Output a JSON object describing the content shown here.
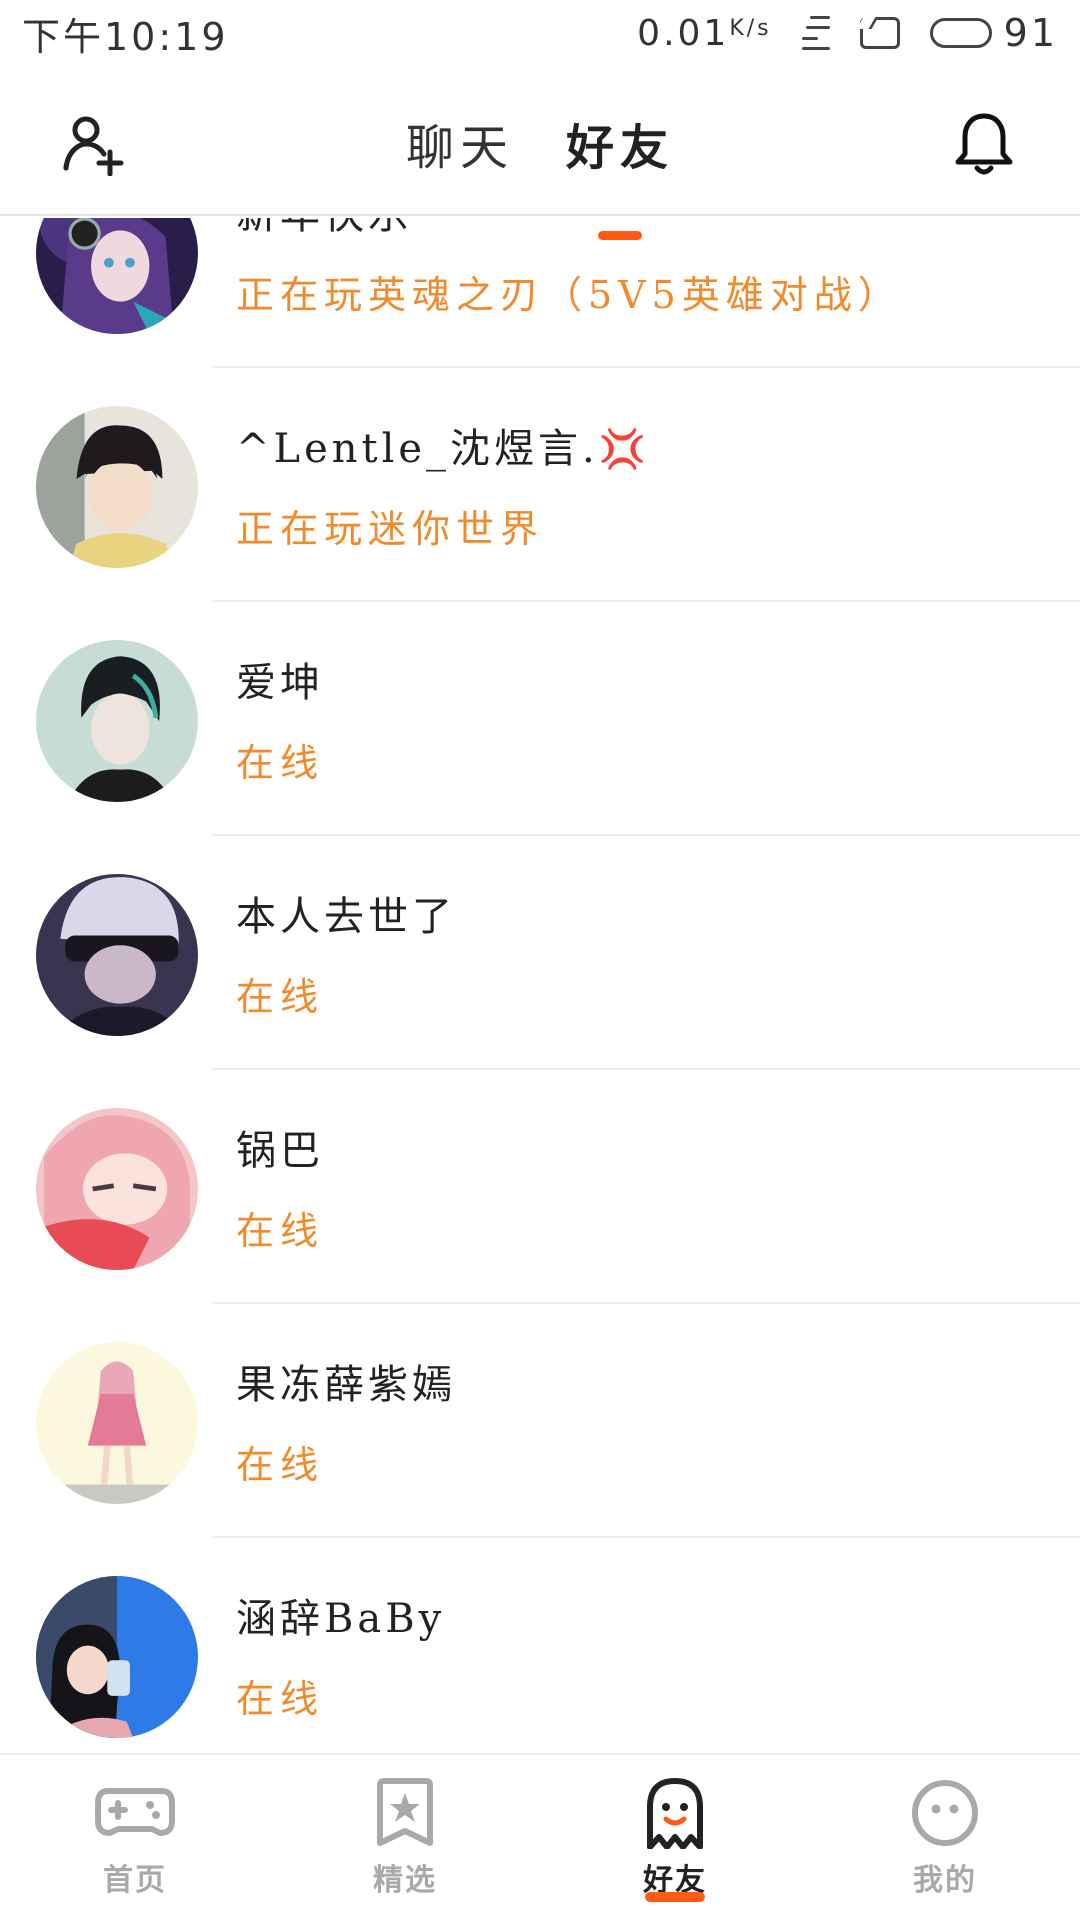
{
  "status_bar": {
    "time": "下午10:19",
    "net_speed": "0.01",
    "net_unit": "K/s",
    "battery_level": "91",
    "battery_fraction": 0.91
  },
  "header": {
    "tabs": [
      {
        "label": "聊天",
        "active": false
      },
      {
        "label": "好友",
        "active": true
      }
    ]
  },
  "friends": [
    {
      "name": "新年快乐",
      "status": "正在玩英魂之刃（5V5英雄对战）"
    },
    {
      "name": "^Lentle_沈煜言.",
      "status": "正在玩迷你世界",
      "emoji": "💢"
    },
    {
      "name": "爱坤",
      "status": "在线"
    },
    {
      "name": "本人去世了",
      "status": "在线"
    },
    {
      "name": "锅巴",
      "status": "在线"
    },
    {
      "name": "果冻薛紫嫣",
      "status": "在线"
    },
    {
      "name": "涵辞BaBy",
      "status": "在线"
    }
  ],
  "bottom_nav": [
    {
      "label": "首页",
      "icon": "gamepad-icon",
      "active": false
    },
    {
      "label": "精选",
      "icon": "star-bookmark-icon",
      "active": false
    },
    {
      "label": "好友",
      "icon": "ghost-icon",
      "active": true
    },
    {
      "label": "我的",
      "icon": "smiley-face-icon",
      "active": false
    }
  ],
  "colors": {
    "accent": "#ff5a14",
    "status_text": "#f08a2a",
    "inactive_nav": "#a9a9a9"
  }
}
